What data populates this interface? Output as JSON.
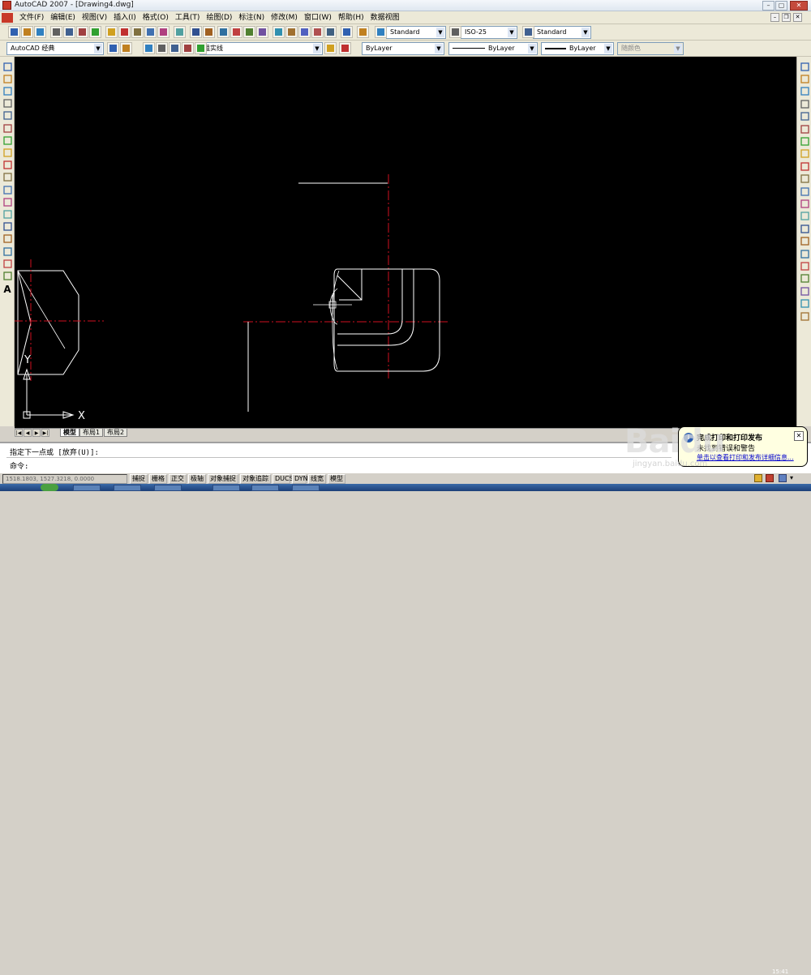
{
  "window": {
    "title": "AutoCAD 2007 - [Drawing4.dwg]"
  },
  "menu": [
    "文件(F)",
    "编辑(E)",
    "视图(V)",
    "插入(I)",
    "格式(O)",
    "工具(T)",
    "绘图(D)",
    "标注(N)",
    "修改(M)",
    "窗口(W)",
    "帮助(H)",
    "数据视图"
  ],
  "styles": {
    "text_style": "Standard",
    "dim_style": "ISO-25",
    "table_style": "Standard"
  },
  "workspace": "AutoCAD 经典",
  "layer": "粗实线",
  "properties": {
    "color": "ByLayer",
    "linetype": "ByLayer",
    "lineweight": "ByLayer",
    "plotstyle": "随颜色"
  },
  "tabs": [
    "模型",
    "布局1",
    "布局2"
  ],
  "command": {
    "line1": "指定下一点或 [放弃(U)]:",
    "line2": "命令:"
  },
  "status": {
    "coords": "1518.1803, 1527.3218, 0.0000",
    "buttons": [
      "捕捉",
      "栅格",
      "正交",
      "极轴",
      "对象捕捉",
      "对象追踪",
      "DUCS",
      "DYN",
      "线宽",
      "模型"
    ]
  },
  "balloon": {
    "title": "完成打印和打印发布",
    "text": "未找到错误和警告",
    "link": "单击以查看打印和发布详细信息..."
  },
  "ucs": {
    "x": "X",
    "y": "Y"
  },
  "clock": "15:41",
  "watermark": {
    "main": "Baidu",
    "sub": "jingyan.baidu.com"
  },
  "colors": {
    "canvas": "#000000",
    "centerline": "#d01020",
    "geometry": "#ffffff"
  }
}
